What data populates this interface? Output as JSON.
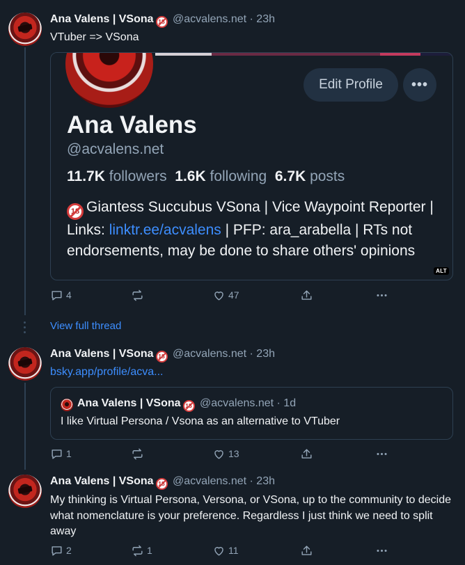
{
  "icons": {
    "reply": "reply-icon",
    "repost": "repost-icon",
    "like": "heart-icon",
    "share": "share-icon",
    "more": "more-icon"
  },
  "colors": {
    "background": "#161e27",
    "link": "#3d8eff",
    "muted": "#93a5b7",
    "adult_badge": "#d43b3b"
  },
  "adult_badge_text": "18",
  "posts": [
    {
      "name": "Ana Valens | VSona",
      "handle": "@acvalens.net",
      "time": "· 23h",
      "text": "VTuber => VSona",
      "embed": {
        "edit_label": "Edit Profile",
        "more_label": "•••",
        "display_name": "Ana Valens",
        "handle": "@acvalens.net",
        "followers_count": "11.7K",
        "followers_label": "followers",
        "following_count": "1.6K",
        "following_label": "following",
        "posts_count": "6.7K",
        "posts_label": "posts",
        "bio_part1": "Giantess Succubus VSona | Vice Waypoint Reporter | Links: ",
        "bio_link": "linktr.ee/acvalens",
        "bio_part2": " | PFP: ara_arabella | RTs not endorsements, may be done to share others' opinions",
        "alt_label": "ALT"
      },
      "replies": "4",
      "reposts": "",
      "likes": "47"
    },
    {
      "name": "Ana Valens | VSona",
      "handle": "@acvalens.net",
      "time": "· 23h",
      "link": "bsky.app/profile/acva...",
      "quote": {
        "name": "Ana Valens | VSona",
        "handle": "@acvalens.net",
        "time": "· 1d",
        "text": "I like Virtual Persona / Vsona as an alternative to VTuber"
      },
      "replies": "1",
      "reposts": "",
      "likes": "13"
    },
    {
      "name": "Ana Valens | VSona",
      "handle": "@acvalens.net",
      "time": "· 23h",
      "text": "My thinking is Virtual Persona, Versona, or VSona, up to the community to decide what nomenclature is your preference. Regardless I just think we need to split away",
      "replies": "2",
      "reposts": "1",
      "likes": "11"
    }
  ],
  "view_full_thread": "View full thread"
}
